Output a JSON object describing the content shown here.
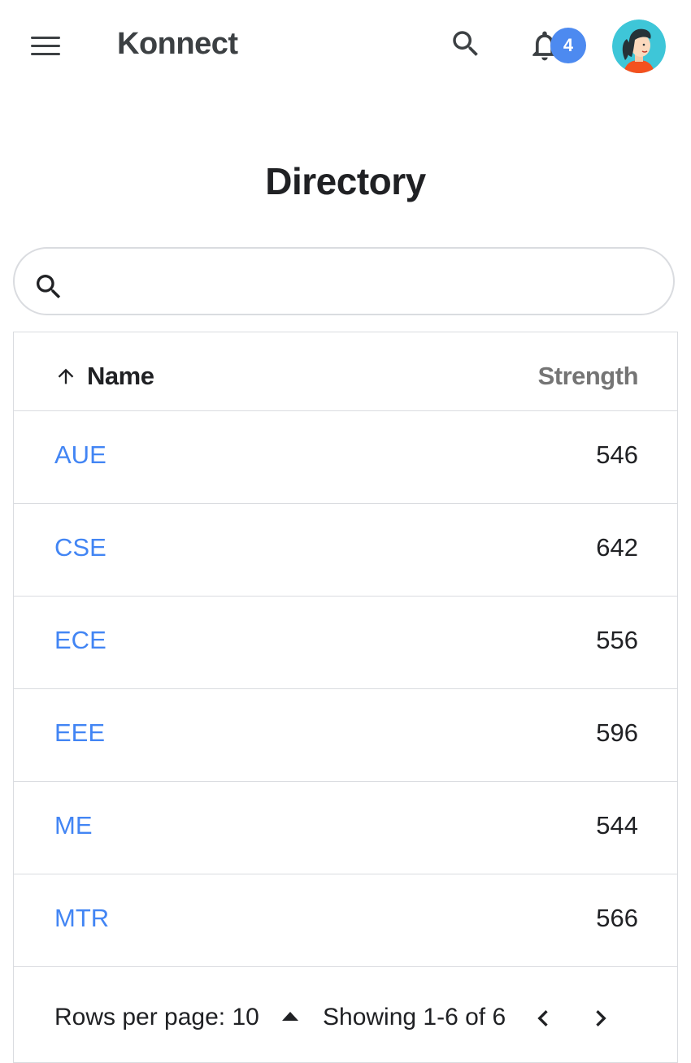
{
  "app": {
    "title": "Konnect",
    "notification_count": "4",
    "accent_color": "#4d8af0"
  },
  "icons": {
    "menu": "menu-icon",
    "search": "search-icon",
    "notifications": "bell-icon",
    "avatar": "user-avatar",
    "sort": "arrow-up-icon",
    "rows_select": "triangle-up-icon",
    "prev": "chevron-left-icon",
    "next": "chevron-right-icon"
  },
  "page": {
    "title": "Directory"
  },
  "search": {
    "placeholder": "",
    "value": ""
  },
  "table": {
    "columns": [
      {
        "label": "Name",
        "sorted": "ascending"
      },
      {
        "label": "Strength"
      }
    ],
    "rows": [
      {
        "name": "AUE",
        "strength": "546"
      },
      {
        "name": "CSE",
        "strength": "642"
      },
      {
        "name": "ECE",
        "strength": "556"
      },
      {
        "name": "EEE",
        "strength": "596"
      },
      {
        "name": "ME",
        "strength": "544"
      },
      {
        "name": "MTR",
        "strength": "566"
      }
    ],
    "link_color": "#4285f4"
  },
  "pagination": {
    "rows_per_page_label": "Rows per page: 10",
    "showing_label": "Showing 1-6 of 6"
  }
}
